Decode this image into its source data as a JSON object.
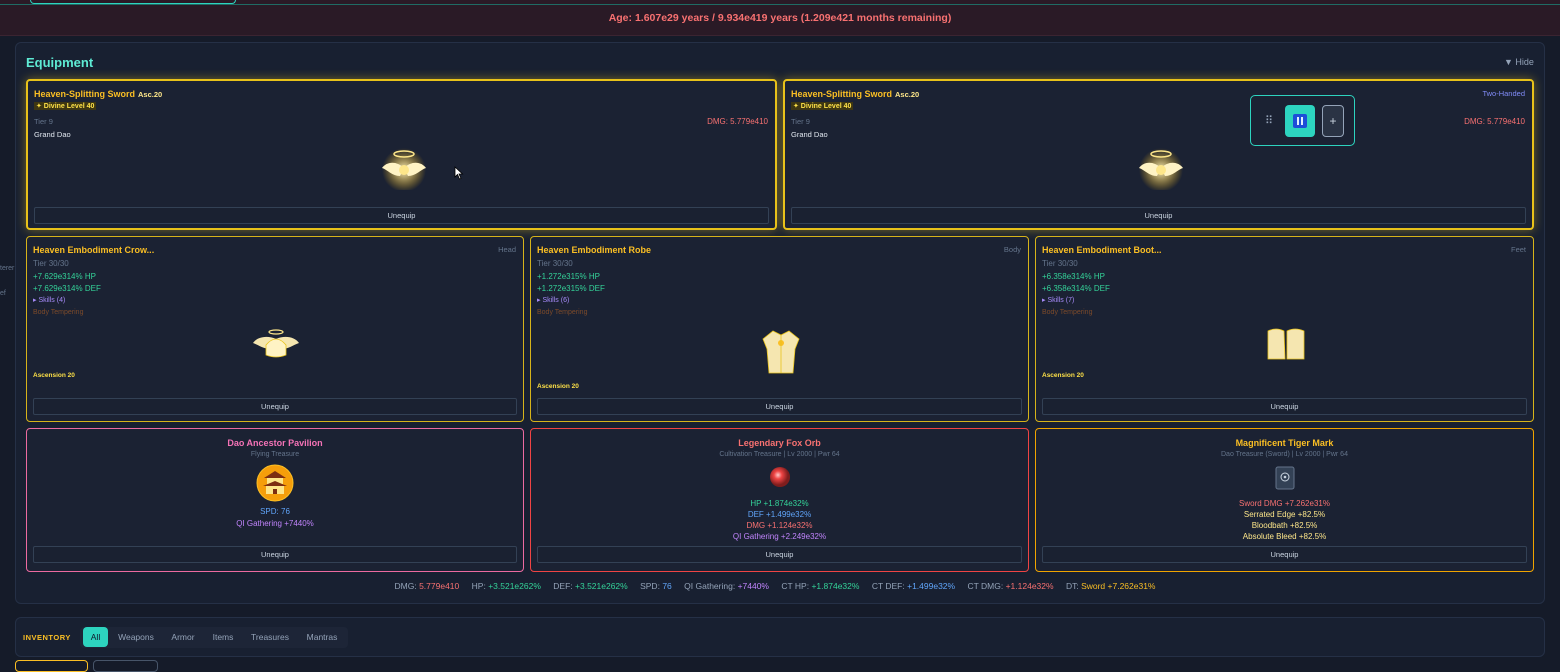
{
  "top": {
    "age_text": "Age: 1.607e29 years / 9.934e419 years (1.209e421 months remaining)"
  },
  "side_fragments": [
    "terer",
    "ef"
  ],
  "equipment": {
    "title": "Equipment",
    "hide_label": "▼ Hide",
    "weapons": [
      {
        "name": "Heaven-Splitting Sword",
        "asc": "Asc.20",
        "divine": "✦ Divine Level 40",
        "tier": "Tier 9",
        "dao": "Grand Dao",
        "dmg": "DMG: 5.779e410",
        "unequip": "Unequip",
        "icon": "winged-halo-icon"
      },
      {
        "name": "Heaven-Splitting Sword",
        "asc": "Asc.20",
        "divine": "✦ Divine Level 40",
        "tier": "Tier 9",
        "dao": "Grand Dao",
        "dmg": "DMG: 5.779e410",
        "two_handed": "Two-Handed",
        "unequip": "Unequip",
        "icon": "winged-halo-icon"
      }
    ],
    "armor": [
      {
        "name": "Heaven Embodiment Crow...",
        "slot": "Head",
        "tier": "Tier 30/30",
        "hp": "+7.629e314% HP",
        "def": "+7.629e314% DEF",
        "skills": "▸ Skills (4)",
        "realm": "Body Tempering",
        "ascension": "Ascension 20",
        "unequip": "Unequip",
        "icon": "winged-crown-icon"
      },
      {
        "name": "Heaven Embodiment Robe",
        "slot": "Body",
        "tier": "Tier 30/30",
        "hp": "+1.272e315% HP",
        "def": "+1.272e315% DEF",
        "skills": "▸ Skills (6)",
        "realm": "Body Tempering",
        "ascension": "Ascension 20",
        "unequip": "Unequip",
        "icon": "robe-icon"
      },
      {
        "name": "Heaven Embodiment Boot...",
        "slot": "Feet",
        "tier": "Tier 30/30",
        "hp": "+6.358e314% HP",
        "def": "+6.358e314% DEF",
        "skills": "▸ Skills (7)",
        "realm": "Body Tempering",
        "ascension": "Ascension 20",
        "unequip": "Unequip",
        "icon": "boots-icon"
      }
    ],
    "treasures": [
      {
        "name": "Dao Ancestor Pavilion",
        "subtitle": "Flying Treasure",
        "lines": [
          "SPD: 76",
          "QI Gathering +7440%"
        ],
        "unequip": "Unequip",
        "name_color": "#f472b6",
        "icon": "pavilion-icon"
      },
      {
        "name": "Legendary Fox Orb",
        "subtitle": "Cultivation Treasure | Lv 2000 | Pwr 64",
        "lines": [
          "HP +1.874e32%",
          "DEF +1.499e32%",
          "DMG +1.124e32%",
          "QI Gathering +2.249e32%"
        ],
        "unequip": "Unequip",
        "name_color": "#f87171",
        "icon": "red-orb-icon"
      },
      {
        "name": "Magnificent Tiger Mark",
        "subtitle": "Dao Treasure (Sword) | Lv 2000 | Pwr 64",
        "lines": [
          "Sword DMG +7.262e31%",
          "Serrated Edge +82.5%",
          "Bloodbath +82.5%",
          "Absolute Bleed +82.5%"
        ],
        "unequip": "Unequip",
        "name_color": "#fbbf24",
        "icon": "tiger-mark-icon"
      }
    ]
  },
  "stats": [
    {
      "label": "DMG:",
      "value": "5.779e410",
      "color": "#f87171"
    },
    {
      "label": "HP:",
      "value": "+3.521e262%",
      "color": "#34d399"
    },
    {
      "label": "DEF:",
      "value": "+3.521e262%",
      "color": "#34d399"
    },
    {
      "label": "SPD:",
      "value": "76",
      "color": "#60a5fa"
    },
    {
      "label": "QI Gathering:",
      "value": "+7440%",
      "color": "#c084fc"
    },
    {
      "label": "CT HP:",
      "value": "+1.874e32%",
      "color": "#34d399"
    },
    {
      "label": "CT DEF:",
      "value": "+1.499e32%",
      "color": "#60a5fa"
    },
    {
      "label": "CT DMG:",
      "value": "+1.124e32%",
      "color": "#f87171"
    },
    {
      "label": "DT:",
      "value": "Sword +7.262e31%",
      "color": "#fbbf24"
    }
  ],
  "inventory": {
    "title": "INVENTORY",
    "tabs": [
      "All",
      "Weapons",
      "Armor",
      "Items",
      "Treasures",
      "Mantras"
    ],
    "active_tab": "All"
  },
  "float_controls": {
    "drag_icon": "⠿",
    "plus": "+"
  }
}
